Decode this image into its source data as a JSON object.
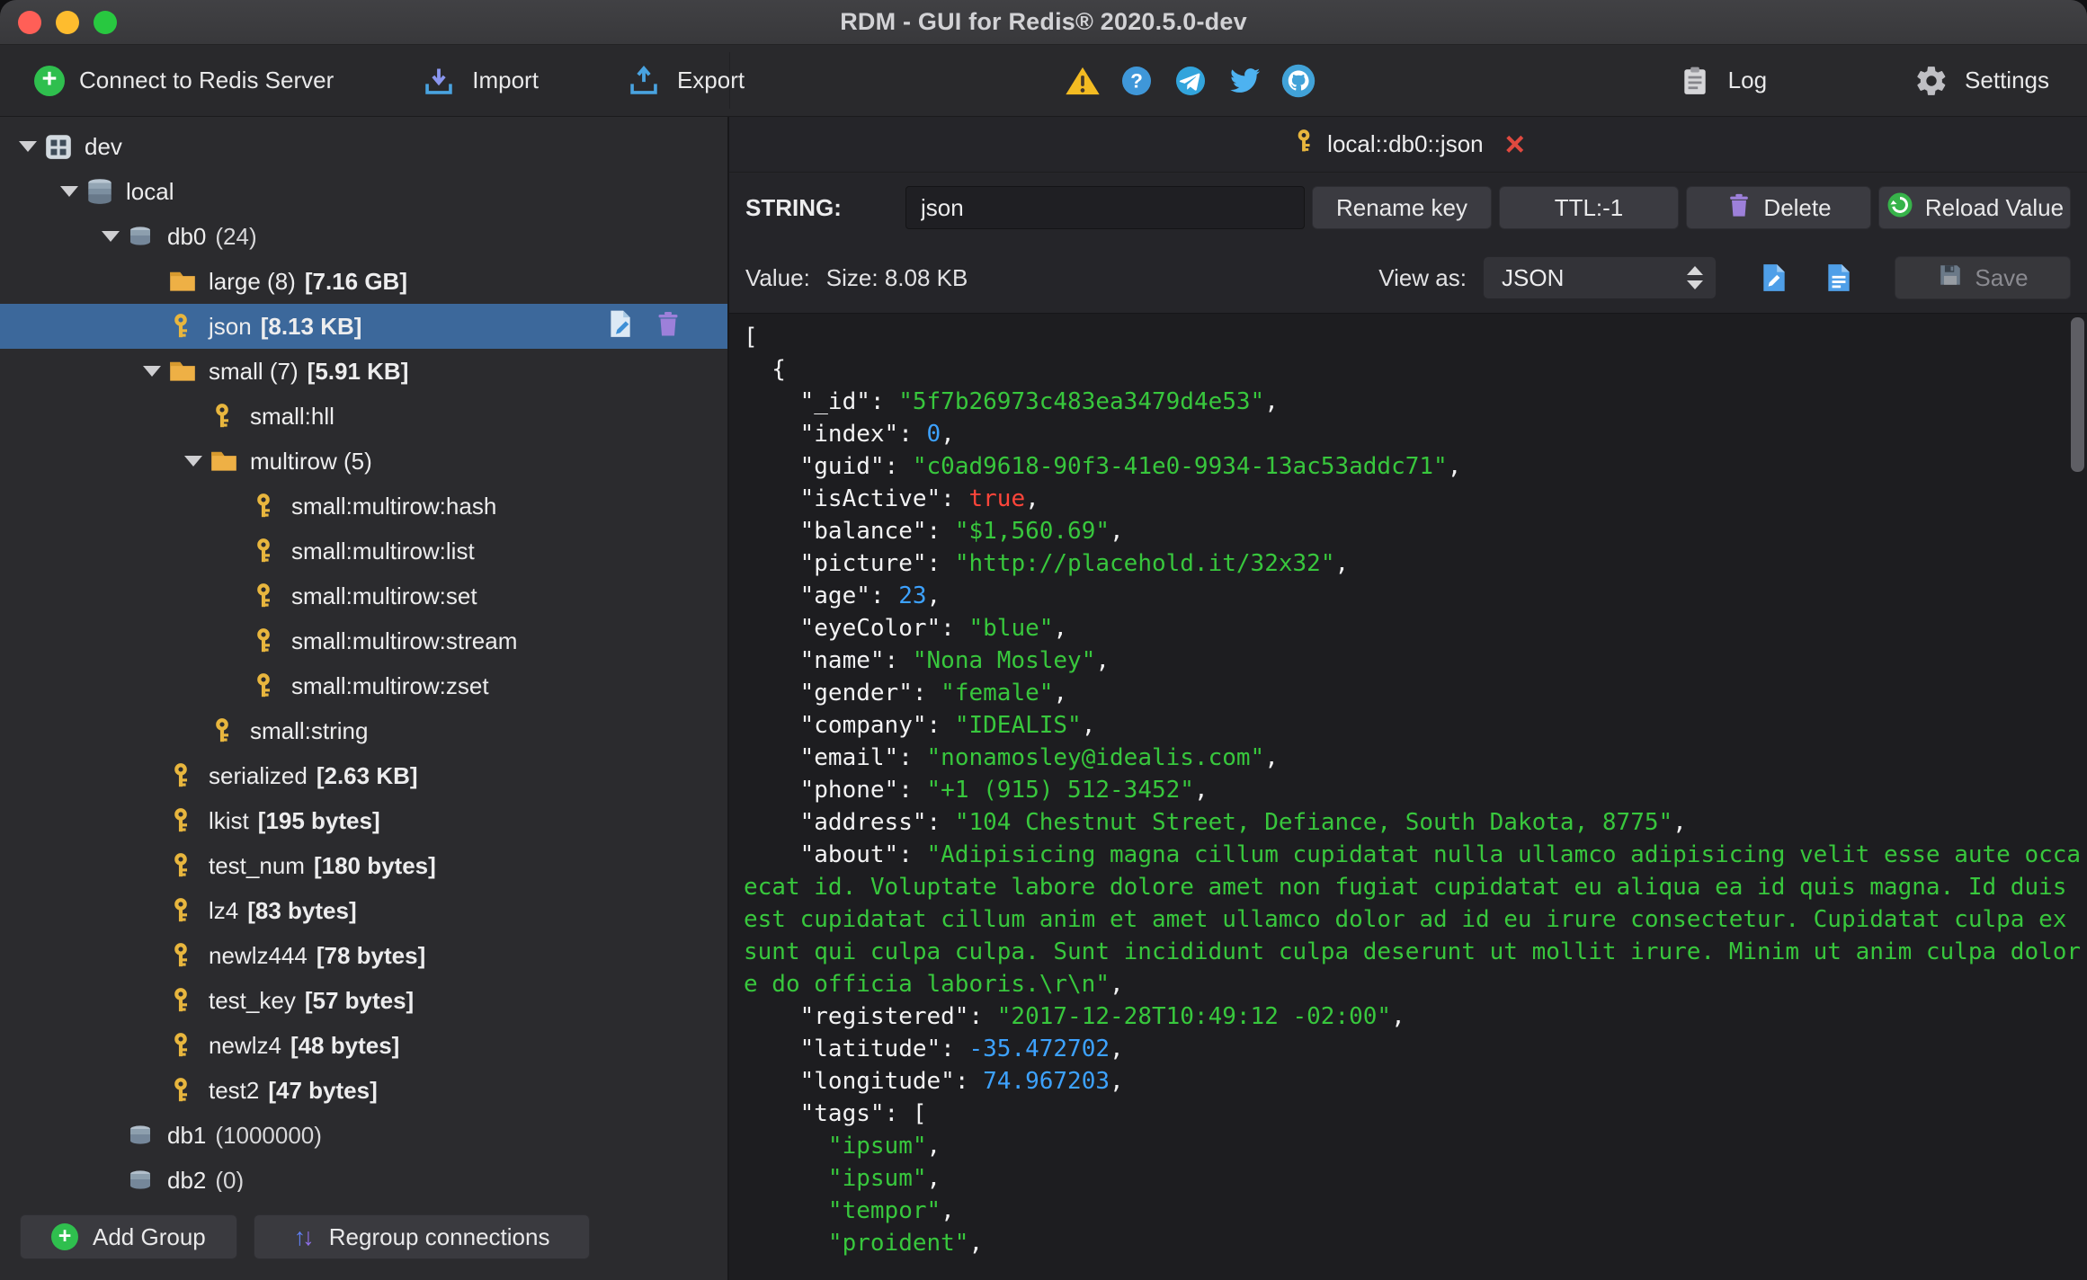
{
  "window": {
    "title": "RDM - GUI for Redis® 2020.5.0-dev"
  },
  "toolbar": {
    "connect_label": "Connect to Redis Server",
    "import_label": "Import",
    "export_label": "Export",
    "log_label": "Log",
    "settings_label": "Settings",
    "status_icons": [
      "warning-icon",
      "help-icon",
      "telegram-icon",
      "twitter-icon",
      "github-icon"
    ]
  },
  "sidebar": {
    "tree": [
      {
        "label": "dev",
        "type": "connection",
        "level": 0,
        "expanded": true
      },
      {
        "label": "local",
        "type": "host",
        "level": 1,
        "expanded": true
      },
      {
        "label": "db0",
        "count": "(24)",
        "type": "db",
        "level": 2,
        "expanded": true
      },
      {
        "label": "large (8)",
        "size": "[7.16 GB]",
        "type": "folder",
        "level": 3
      },
      {
        "label": "json",
        "size": "[8.13 KB]",
        "type": "key",
        "level": 3,
        "selected": true
      },
      {
        "label": "small (7)",
        "size": "[5.91 KB]",
        "type": "folder",
        "level": 3,
        "expanded": true
      },
      {
        "label": "small:hll",
        "type": "key",
        "level": 4
      },
      {
        "label": "multirow (5)",
        "type": "folder",
        "level": 4,
        "expanded": true
      },
      {
        "label": "small:multirow:hash",
        "type": "key",
        "level": 5
      },
      {
        "label": "small:multirow:list",
        "type": "key",
        "level": 5
      },
      {
        "label": "small:multirow:set",
        "type": "key",
        "level": 5
      },
      {
        "label": "small:multirow:stream",
        "type": "key",
        "level": 5
      },
      {
        "label": "small:multirow:zset",
        "type": "key",
        "level": 5
      },
      {
        "label": "small:string",
        "type": "key",
        "level": 4
      },
      {
        "label": "serialized",
        "size": "[2.63 KB]",
        "type": "key",
        "level": 3
      },
      {
        "label": "lkist",
        "size": "[195 bytes]",
        "type": "key",
        "level": 3
      },
      {
        "label": "test_num",
        "size": "[180 bytes]",
        "type": "key",
        "level": 3
      },
      {
        "label": "lz4",
        "size": "[83 bytes]",
        "type": "key",
        "level": 3
      },
      {
        "label": "newlz444",
        "size": "[78 bytes]",
        "type": "key",
        "level": 3
      },
      {
        "label": "test_key",
        "size": "[57 bytes]",
        "type": "key",
        "level": 3
      },
      {
        "label": "newlz4",
        "size": "[48 bytes]",
        "type": "key",
        "level": 3
      },
      {
        "label": "test2",
        "size": "[47 bytes]",
        "type": "key",
        "level": 3
      },
      {
        "label": "db1",
        "count": "(1000000)",
        "type": "db",
        "level": 2
      },
      {
        "label": "db2",
        "count": "(0)",
        "type": "db",
        "level": 2
      }
    ],
    "add_group_label": "Add Group",
    "regroup_label": "Regroup connections"
  },
  "editor": {
    "tab_title": "local::db0::json",
    "type_label": "STRING:",
    "key_name": "json",
    "rename_label": "Rename key",
    "ttl_label": "TTL:-1",
    "delete_label": "Delete",
    "reload_label": "Reload Value",
    "value_label": "Value:",
    "size_label": "Size: 8.08 KB",
    "view_as_label": "View as:",
    "view_as_value": "JSON",
    "save_label": "Save",
    "json_lines": [
      [
        {
          "t": "p",
          "v": "["
        }
      ],
      [
        {
          "t": "p",
          "v": "  {"
        }
      ],
      [
        {
          "t": "p",
          "v": "    "
        },
        {
          "t": "k",
          "v": "\"_id\""
        },
        {
          "t": "p",
          "v": ": "
        },
        {
          "t": "s",
          "v": "\"5f7b26973c483ea3479d4e53\""
        },
        {
          "t": "p",
          "v": ","
        }
      ],
      [
        {
          "t": "p",
          "v": "    "
        },
        {
          "t": "k",
          "v": "\"index\""
        },
        {
          "t": "p",
          "v": ": "
        },
        {
          "t": "n",
          "v": "0"
        },
        {
          "t": "p",
          "v": ","
        }
      ],
      [
        {
          "t": "p",
          "v": "    "
        },
        {
          "t": "k",
          "v": "\"guid\""
        },
        {
          "t": "p",
          "v": ": "
        },
        {
          "t": "s",
          "v": "\"c0ad9618-90f3-41e0-9934-13ac53addc71\""
        },
        {
          "t": "p",
          "v": ","
        }
      ],
      [
        {
          "t": "p",
          "v": "    "
        },
        {
          "t": "k",
          "v": "\"isActive\""
        },
        {
          "t": "p",
          "v": ": "
        },
        {
          "t": "b",
          "v": "true"
        },
        {
          "t": "p",
          "v": ","
        }
      ],
      [
        {
          "t": "p",
          "v": "    "
        },
        {
          "t": "k",
          "v": "\"balance\""
        },
        {
          "t": "p",
          "v": ": "
        },
        {
          "t": "s",
          "v": "\"$1,560.69\""
        },
        {
          "t": "p",
          "v": ","
        }
      ],
      [
        {
          "t": "p",
          "v": "    "
        },
        {
          "t": "k",
          "v": "\"picture\""
        },
        {
          "t": "p",
          "v": ": "
        },
        {
          "t": "s",
          "v": "\"http://placehold.it/32x32\""
        },
        {
          "t": "p",
          "v": ","
        }
      ],
      [
        {
          "t": "p",
          "v": "    "
        },
        {
          "t": "k",
          "v": "\"age\""
        },
        {
          "t": "p",
          "v": ": "
        },
        {
          "t": "n",
          "v": "23"
        },
        {
          "t": "p",
          "v": ","
        }
      ],
      [
        {
          "t": "p",
          "v": "    "
        },
        {
          "t": "k",
          "v": "\"eyeColor\""
        },
        {
          "t": "p",
          "v": ": "
        },
        {
          "t": "s",
          "v": "\"blue\""
        },
        {
          "t": "p",
          "v": ","
        }
      ],
      [
        {
          "t": "p",
          "v": "    "
        },
        {
          "t": "k",
          "v": "\"name\""
        },
        {
          "t": "p",
          "v": ": "
        },
        {
          "t": "s",
          "v": "\"Nona Mosley\""
        },
        {
          "t": "p",
          "v": ","
        }
      ],
      [
        {
          "t": "p",
          "v": "    "
        },
        {
          "t": "k",
          "v": "\"gender\""
        },
        {
          "t": "p",
          "v": ": "
        },
        {
          "t": "s",
          "v": "\"female\""
        },
        {
          "t": "p",
          "v": ","
        }
      ],
      [
        {
          "t": "p",
          "v": "    "
        },
        {
          "t": "k",
          "v": "\"company\""
        },
        {
          "t": "p",
          "v": ": "
        },
        {
          "t": "s",
          "v": "\"IDEALIS\""
        },
        {
          "t": "p",
          "v": ","
        }
      ],
      [
        {
          "t": "p",
          "v": "    "
        },
        {
          "t": "k",
          "v": "\"email\""
        },
        {
          "t": "p",
          "v": ": "
        },
        {
          "t": "s",
          "v": "\"nonamosley@idealis.com\""
        },
        {
          "t": "p",
          "v": ","
        }
      ],
      [
        {
          "t": "p",
          "v": "    "
        },
        {
          "t": "k",
          "v": "\"phone\""
        },
        {
          "t": "p",
          "v": ": "
        },
        {
          "t": "s",
          "v": "\"+1 (915) 512-3452\""
        },
        {
          "t": "p",
          "v": ","
        }
      ],
      [
        {
          "t": "p",
          "v": "    "
        },
        {
          "t": "k",
          "v": "\"address\""
        },
        {
          "t": "p",
          "v": ": "
        },
        {
          "t": "s",
          "v": "\"104 Chestnut Street, Defiance, South Dakota, 8775\""
        },
        {
          "t": "p",
          "v": ","
        }
      ],
      [
        {
          "t": "p",
          "v": "    "
        },
        {
          "t": "k",
          "v": "\"about\""
        },
        {
          "t": "p",
          "v": ": "
        },
        {
          "t": "s",
          "v": "\"Adipisicing magna cillum cupidatat nulla ullamco adipisicing velit esse aute occa"
        }
      ],
      [
        {
          "t": "s",
          "v": "ecat id. Voluptate labore dolore amet non fugiat cupidatat eu aliqua ea id quis magna. Id duis "
        }
      ],
      [
        {
          "t": "s",
          "v": "est cupidatat cillum anim et amet ullamco dolor ad id eu irure consectetur. Cupidatat culpa ex "
        }
      ],
      [
        {
          "t": "s",
          "v": "sunt qui culpa culpa. Sunt incididunt culpa deserunt ut mollit irure. Minim ut anim culpa dolor"
        }
      ],
      [
        {
          "t": "s",
          "v": "e do officia laboris.\\r\\n\""
        },
        {
          "t": "p",
          "v": ","
        }
      ],
      [
        {
          "t": "p",
          "v": "    "
        },
        {
          "t": "k",
          "v": "\"registered\""
        },
        {
          "t": "p",
          "v": ": "
        },
        {
          "t": "s",
          "v": "\"2017-12-28T10:49:12 -02:00\""
        },
        {
          "t": "p",
          "v": ","
        }
      ],
      [
        {
          "t": "p",
          "v": "    "
        },
        {
          "t": "k",
          "v": "\"latitude\""
        },
        {
          "t": "p",
          "v": ": "
        },
        {
          "t": "n",
          "v": "-35.472702"
        },
        {
          "t": "p",
          "v": ","
        }
      ],
      [
        {
          "t": "p",
          "v": "    "
        },
        {
          "t": "k",
          "v": "\"longitude\""
        },
        {
          "t": "p",
          "v": ": "
        },
        {
          "t": "n",
          "v": "74.967203"
        },
        {
          "t": "p",
          "v": ","
        }
      ],
      [
        {
          "t": "p",
          "v": "    "
        },
        {
          "t": "k",
          "v": "\"tags\""
        },
        {
          "t": "p",
          "v": ": ["
        }
      ],
      [
        {
          "t": "p",
          "v": "      "
        },
        {
          "t": "s",
          "v": "\"ipsum\""
        },
        {
          "t": "p",
          "v": ","
        }
      ],
      [
        {
          "t": "p",
          "v": "      "
        },
        {
          "t": "s",
          "v": "\"ipsum\""
        },
        {
          "t": "p",
          "v": ","
        }
      ],
      [
        {
          "t": "p",
          "v": "      "
        },
        {
          "t": "s",
          "v": "\"tempor\""
        },
        {
          "t": "p",
          "v": ","
        }
      ],
      [
        {
          "t": "p",
          "v": "      "
        },
        {
          "t": "s",
          "v": "\"proident\""
        },
        {
          "t": "p",
          "v": ","
        }
      ]
    ]
  }
}
